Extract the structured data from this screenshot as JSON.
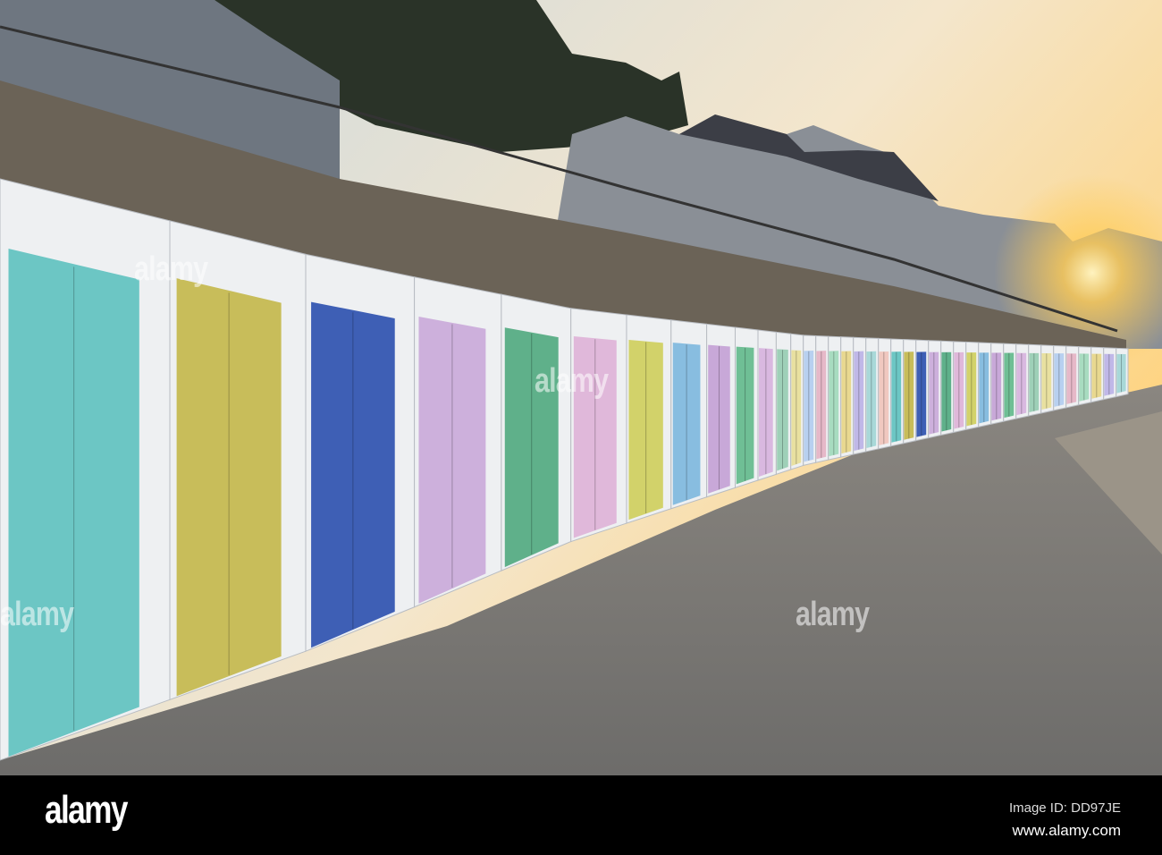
{
  "photo": {
    "hut_door_colors": [
      "#6cc6c4",
      "#c8bd5a",
      "#3e5fb5",
      "#cdb0dc",
      "#5fb08a",
      "#e0b8da",
      "#d2d26a",
      "#88bde0",
      "#c8a8d8",
      "#6fbf95",
      "#d9b8e0",
      "#9ed0b8",
      "#e8e0a0",
      "#b8d0f0",
      "#e6b8c8",
      "#a8dcc0",
      "#e8d890",
      "#c0b8e8",
      "#a8d8d8",
      "#f0c8c0"
    ],
    "sky_colors": [
      "#c9d8e2",
      "#f6e9c8",
      "#ffd070"
    ],
    "sun_glow": "#ffcc55"
  },
  "watermark": {
    "text": "alamy"
  },
  "footer": {
    "logo": "alamy",
    "image_id": "Image ID: DD97JE",
    "url": "www.alamy.com"
  }
}
